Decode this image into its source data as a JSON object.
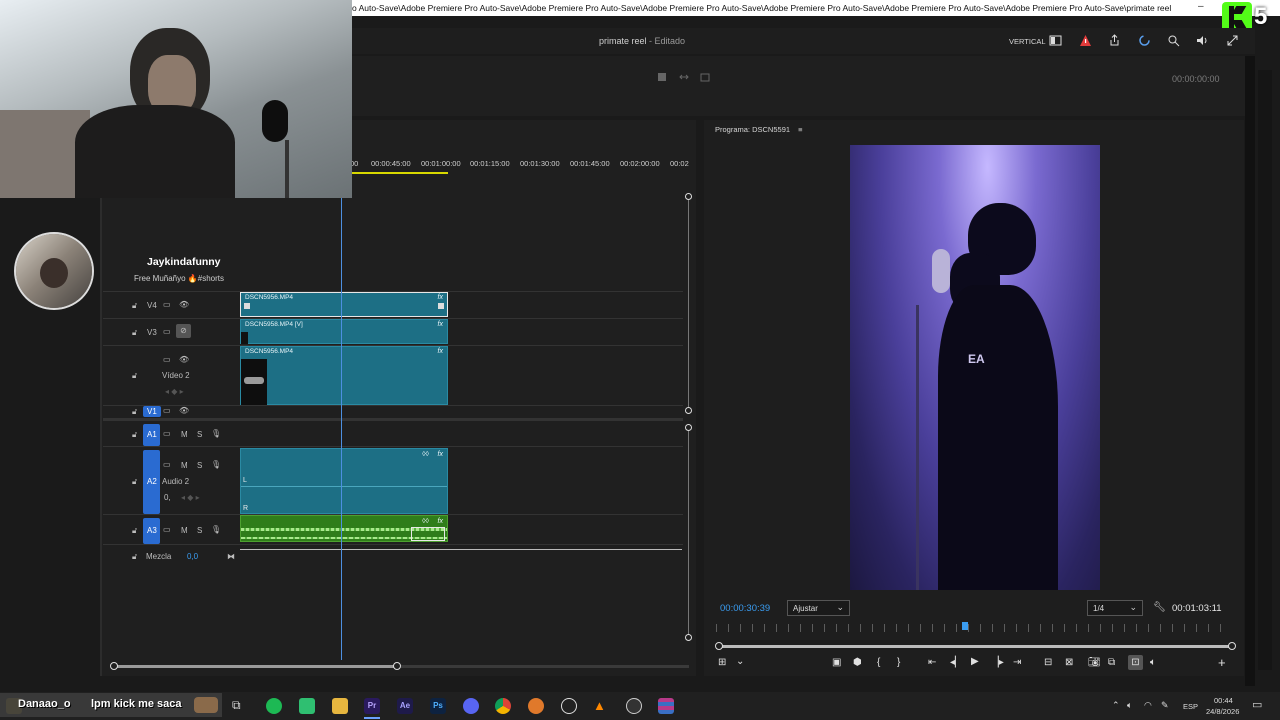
{
  "titlebar": {
    "path": "o Auto-Save\\Adobe Premiere Pro Auto-Save\\Adobe Premiere Pro Auto-Save\\Adobe Premiere Pro Auto-Save\\Adobe Premiere Pro Auto-Save\\Adobe Premiere Pro Auto-Save\\Adobe Premiere Pro Auto-Save\\primate reel",
    "minimize": "–"
  },
  "header": {
    "project": "primate reel",
    "status": " - Editado",
    "layout_label": "VERTICAL"
  },
  "upper": {
    "timecode": "00:00:00:00"
  },
  "streamer": {
    "name": "Jaykindafunny",
    "subtitle": "Free Muñañyo 🔥#shorts",
    "badge": "5"
  },
  "timeline": {
    "ruler": [
      "00",
      "00:00:45:00",
      "00:01:00:00",
      "00:01:15:00",
      "00:01:30:00",
      "00:01:45:00",
      "00:02:00:00",
      "00:02"
    ],
    "video_tracks": [
      {
        "id": "V4",
        "name": ""
      },
      {
        "id": "V3",
        "name": ""
      },
      {
        "id": "V2",
        "name": "Vídeo 2"
      },
      {
        "id": "V1",
        "name": ""
      }
    ],
    "audio_tracks": [
      {
        "id": "A1",
        "name": ""
      },
      {
        "id": "A2",
        "name": "Audio 2"
      },
      {
        "id": "A3",
        "name": ""
      }
    ],
    "mix_label": "Mezcla",
    "mix_value": "0,0",
    "clips": {
      "v4": "DSCN5956.MP4",
      "v3": "DSCN5958.MP4 [V]",
      "v2": "DSCN5956.MP4"
    },
    "track_toggles": {
      "m": "M",
      "s": "S"
    },
    "audio_channels": {
      "l": "L",
      "r": "R"
    },
    "a2_level": "0,"
  },
  "program": {
    "title": "Programa: DSCN5591",
    "timecode_in": "00:00:30:39",
    "fit": "Ajustar",
    "resolution": "1/4",
    "timecode_out": "00:01:03:11",
    "playhead_fraction": 0.48
  },
  "taskbar": {
    "chat_user": "Danaao_o",
    "chat_msg": "lpm kick me saca",
    "lang": "ESP",
    "time": "00:44",
    "date": "24/8/2026"
  },
  "colors": {
    "clip_teal": "#1d6f85",
    "audio_green": "#2f7d1a",
    "track_blue": "#2a6bd1",
    "timecode_blue": "#3a9cf0"
  }
}
